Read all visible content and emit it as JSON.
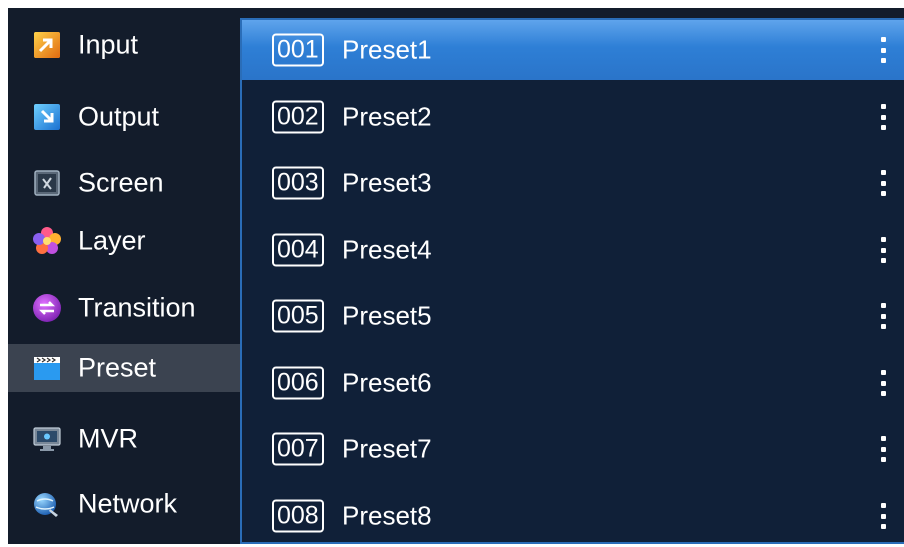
{
  "sidebar": {
    "items": [
      {
        "label": "Input",
        "icon": "input-icon"
      },
      {
        "label": "Output",
        "icon": "output-icon"
      },
      {
        "label": "Screen",
        "icon": "screen-icon"
      },
      {
        "label": "Layer",
        "icon": "layer-icon"
      },
      {
        "label": "Transition",
        "icon": "transition-icon"
      },
      {
        "label": "Preset",
        "icon": "preset-icon",
        "active": true
      },
      {
        "label": "MVR",
        "icon": "mvr-icon"
      },
      {
        "label": "Network",
        "icon": "network-icon"
      }
    ]
  },
  "presets": [
    {
      "number": "001",
      "name": "Preset1",
      "selected": true
    },
    {
      "number": "002",
      "name": "Preset2"
    },
    {
      "number": "003",
      "name": "Preset3"
    },
    {
      "number": "004",
      "name": "Preset4"
    },
    {
      "number": "005",
      "name": "Preset5"
    },
    {
      "number": "006",
      "name": "Preset6"
    },
    {
      "number": "007",
      "name": "Preset7"
    },
    {
      "number": "008",
      "name": "Preset8"
    }
  ],
  "colors": {
    "background": "#131c2b",
    "list_background": "#102038",
    "selected_row": "#2e7fd6",
    "active_sidebar": "#3b4350",
    "list_border": "#2a6db8"
  }
}
